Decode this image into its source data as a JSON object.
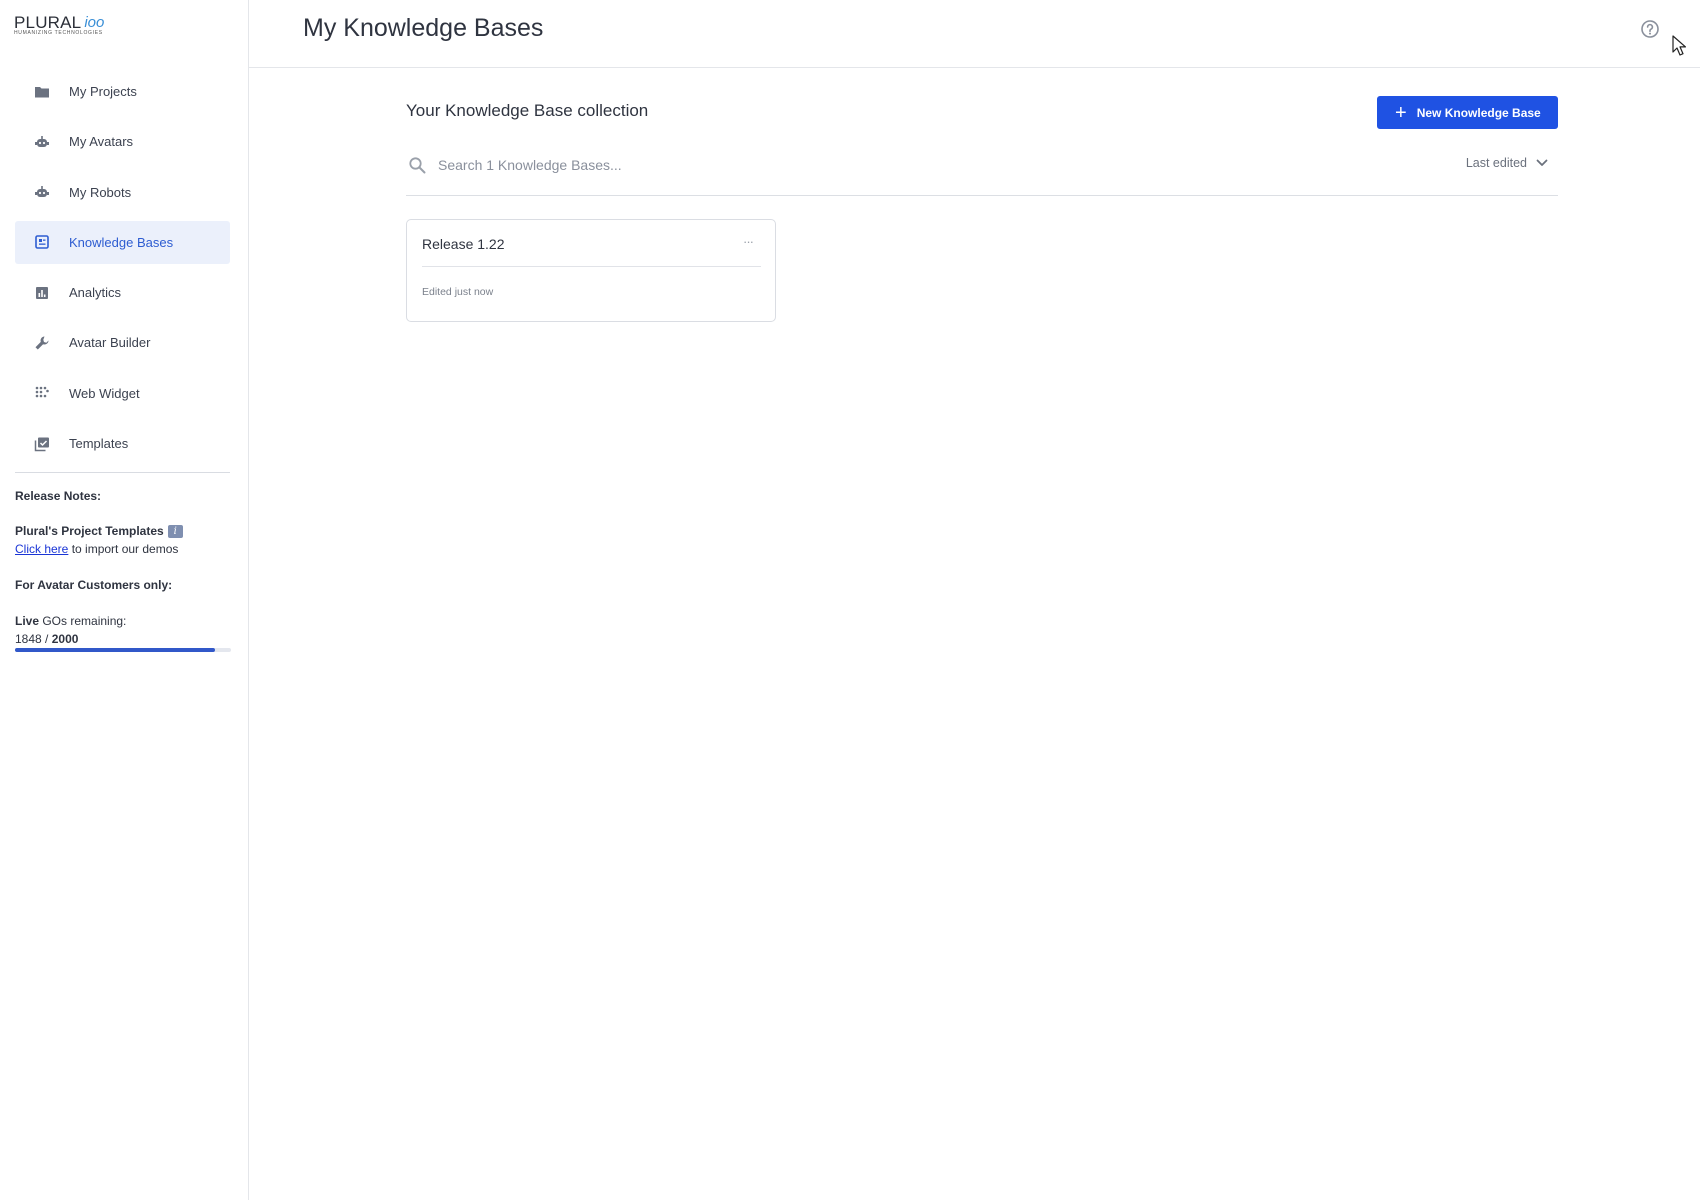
{
  "brand": {
    "name": "PLURAL",
    "mark": "ioo",
    "tagline": "HUMANIZING TECHNOLOGIES"
  },
  "sidebar": {
    "items": [
      {
        "label": "My Projects",
        "icon": "folder-icon",
        "active": false
      },
      {
        "label": "My Avatars",
        "icon": "robot-icon",
        "active": false
      },
      {
        "label": "My Robots",
        "icon": "robot-icon",
        "active": false
      },
      {
        "label": "Knowledge Bases",
        "icon": "knowledge-base-icon",
        "active": true
      },
      {
        "label": "Analytics",
        "icon": "bar-chart-icon",
        "active": false
      },
      {
        "label": "Avatar Builder",
        "icon": "wrench-icon",
        "active": false
      },
      {
        "label": "Web Widget",
        "icon": "widget-grid-icon",
        "active": false
      },
      {
        "label": "Templates",
        "icon": "templates-icon",
        "active": false
      }
    ],
    "release_notes_label": "Release Notes:",
    "templates_heading": "Plural's Project Templates",
    "templates_info": "i",
    "click_here": "Click here",
    "import_text": " to import our demos",
    "avatar_customers": "For Avatar Customers only:",
    "live_label": "Live",
    "gos_remaining": " GOs remaining:",
    "gos_used": "1848",
    "gos_separator": " / ",
    "gos_total": "2000",
    "gos_fraction": 0.924
  },
  "header": {
    "title": "My Knowledge Bases"
  },
  "main": {
    "section_title": "Your Knowledge Base collection",
    "new_button_label": "New Knowledge Base",
    "search_placeholder": "Search 1 Knowledge Bases...",
    "sort_label": "Last edited",
    "cards": [
      {
        "title": "Release 1.22",
        "meta": "Edited just now",
        "menu": "···"
      }
    ]
  },
  "colors": {
    "accent": "#1f52e3",
    "active_bg": "#ebf0fb",
    "active_text": "#2d5cd1",
    "progress": "#3158c9"
  }
}
